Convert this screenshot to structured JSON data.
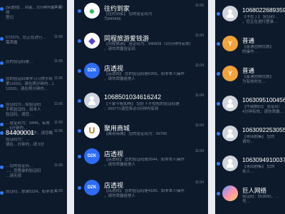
{
  "left": [
    {
      "preview": "[店透视] …到家，3分钟内输入有效\n登记",
      "time": "11:06"
    },
    {
      "preview": "572979，您正在进行…\n需泄露",
      "time": "11:06"
    },
    {
      "preview": "您的验证码是…",
      "time": "11:06"
    },
    {
      "preview": "您的验证码单学习习惯手机\n第12020，请在两分钟内…1\n12020，请在两分钟内…",
      "time": "11:06"
    },
    {
      "preview": "验证码为…如验证码\n手机验证码…如本人\n验证码，请您…",
      "time": "11:06"
    },
    {
      "preview": "…验证码为：0444，有效\n…6分钟内…\n…，如非本人操作，请忽略",
      "time": "11:06"
    },
    {
      "title": "84400001",
      "preview": "验证码为：…\n请在…分钟内…请 5分",
      "time": "11:06"
    },
    {
      "preview": "…您的验证码…\n…，您登录的验证码\n…请无视",
      "time": "11:06"
    },
    {
      "preview": "验证码…登录5324，如非本人",
      "time": "11:06"
    }
  ],
  "mid": [
    {
      "icon": "app-green-icon",
      "title": "往约到家",
      "preview": "【往约到家】 您的验证码为\n为849456",
      "time": "11:05"
    },
    {
      "icon": "app-purple-icon",
      "title": "同程旅游爱钱游",
      "preview": "【同程旅游】 验证码为：940828（10分钟内有效）\n，请勿泄露验证码",
      "time": "11:04"
    },
    {
      "icon": "app-blue-icon",
      "title": "店透视",
      "preview": "【店透视】 您的验证码是6269，如非本人操作\n，请勿泄露给他人",
      "time": "11:04"
    },
    {
      "icon": "person-icon",
      "title": "1068501034616242",
      "preview": "【十蒙今租如啊】 您好下手短短的验证码是\n：665771请您务必3分钟内有效",
      "time": "11:04"
    },
    {
      "icon": "app-brown-icon",
      "title": "聚用商城",
      "preview": "【聚用商城】 您的验证码为：56766",
      "time": "11:04"
    },
    {
      "icon": "app-blue-icon",
      "title": "店透视",
      "preview": "【店透视】 您的验证码是2644，如非本人操作\n，请勿泄露给他人",
      "time": "11:04"
    },
    {
      "icon": "app-blue-icon",
      "title": "店透视",
      "preview": "【店透视】 您的验证码是4189，如非本人操作\n，请勿泄露给他人",
      "time": "11:04"
    }
  ],
  "right": [
    {
      "icon": "person-icon",
      "title": "1068022689359",
      "preview": "【卡拉丁】 验证码…\n，您正在进行登录…"
    },
    {
      "icon": "app-orange-icon",
      "title": "普通",
      "preview": "【普通团购优惠】\n的操作…"
    },
    {
      "icon": "app-orange-icon",
      "title": "普通",
      "preview": "【普通团购优惠】\n为有效时长…"
    },
    {
      "icon": "person-icon",
      "title": "1063095100456",
      "preview": "【华骏数码】 验证码：…\n4分钟有效，请勿泄露…"
    },
    {
      "icon": "person-icon",
      "title": "1063092253055",
      "preview": "【来回剧集】 您的\n请勿…"
    },
    {
      "icon": "person-icon",
      "title": "1063094910037",
      "preview": "【来回剧集】 您的\n本人…"
    },
    {
      "icon": "app-multi-icon",
      "title": "巨人网络",
      "preview": "验证码：553650，…\n号…"
    }
  ]
}
